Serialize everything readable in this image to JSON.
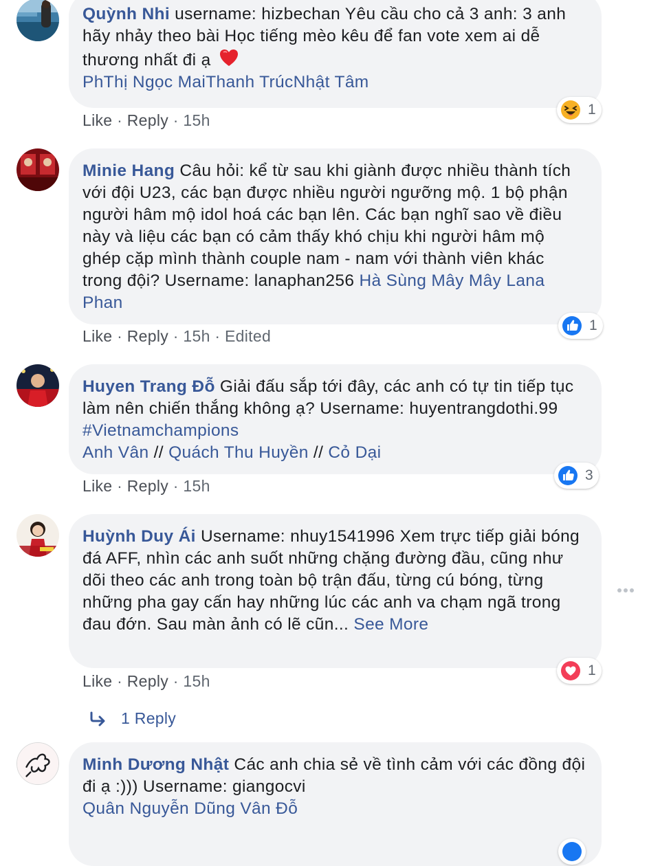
{
  "comments": [
    {
      "author": "Quỳnh Nhi",
      "text": " username: hizbechan Yêu cầu cho cả 3 anh: 3 anh hãy nhảy theo bài Học tiếng mèo kêu để fan vote xem ai dễ thương nhất đi ạ",
      "heart_emoji": "❤️",
      "tags": [
        "Ph",
        "Thị Ngọc Mai",
        "Thanh Trúc",
        "Nhật Tâm"
      ],
      "like_label": "Like",
      "reply_label": "Reply",
      "time": "15h",
      "reaction": {
        "type": "haha-icon",
        "count": "1"
      }
    },
    {
      "author": "Minie Hang",
      "text": " Câu hỏi: kể từ sau khi giành được nhiều thành tích với đội U23, các bạn được nhiều người ngưỡng mộ. 1 bộ phận người hâm mộ idol hoá các bạn lên. Các bạn nghĩ sao về điều này và liệu các bạn có cảm thấy khó chịu khi người hâm mộ ghép cặp mình thành couple nam - nam với thành viên khác trong đội? Username: lanaphan256 ",
      "tags": [
        "Hà Sùng Mây Mây",
        "Lana Phan"
      ],
      "like_label": "Like",
      "reply_label": "Reply",
      "time": "15h",
      "edited": "Edited",
      "reaction": {
        "type": "like-icon",
        "count": "1"
      }
    },
    {
      "author": "Huyen Trang Đỗ",
      "text": " Giải đấu sắp tới đây, các anh có tự tin tiếp tục làm nên chiến thắng không ạ? Username: huyentrangdothi.99 ",
      "hashtag": "#Vietnamchampions",
      "tags": [
        "Anh Vân",
        "Quách Thu Huyền",
        "Cỏ Dại"
      ],
      "separator": " // ",
      "like_label": "Like",
      "reply_label": "Reply",
      "time": "15h",
      "reaction": {
        "type": "like-icon",
        "count": "3"
      }
    },
    {
      "author": "Huỳnh Duy Ái",
      "text": " Username: nhuy1541996 Xem trực tiếp giải bóng đá AFF, nhìn các anh suốt những chặng đường đầu, cũng như dõi theo các anh trong toàn bộ trận đấu, từng cú bóng, từng những pha gay cấn hay những lúc các anh va chạm ngã trong đau đớn. Sau màn ảnh có lẽ cũn...",
      "see_more": "See More",
      "like_label": "Like",
      "reply_label": "Reply",
      "time": "15h",
      "reaction": {
        "type": "love-icon",
        "count": "1"
      },
      "replies_label": "1 Reply"
    },
    {
      "author": "Minh Dương Nhật",
      "text": " Các anh chia sẻ về tình cảm với các đồng đội đi ạ :))) Username: giangocvi",
      "tags": [
        "Quân Nguyễn",
        "Dũng Vân Đỗ"
      ]
    }
  ],
  "colors": {
    "link": "#385898",
    "bubble": "#f2f3f5",
    "meta": "#606770",
    "like_blue": "#1877f2",
    "love_red": "#f33e58",
    "haha_yellow": "#f7b125"
  }
}
